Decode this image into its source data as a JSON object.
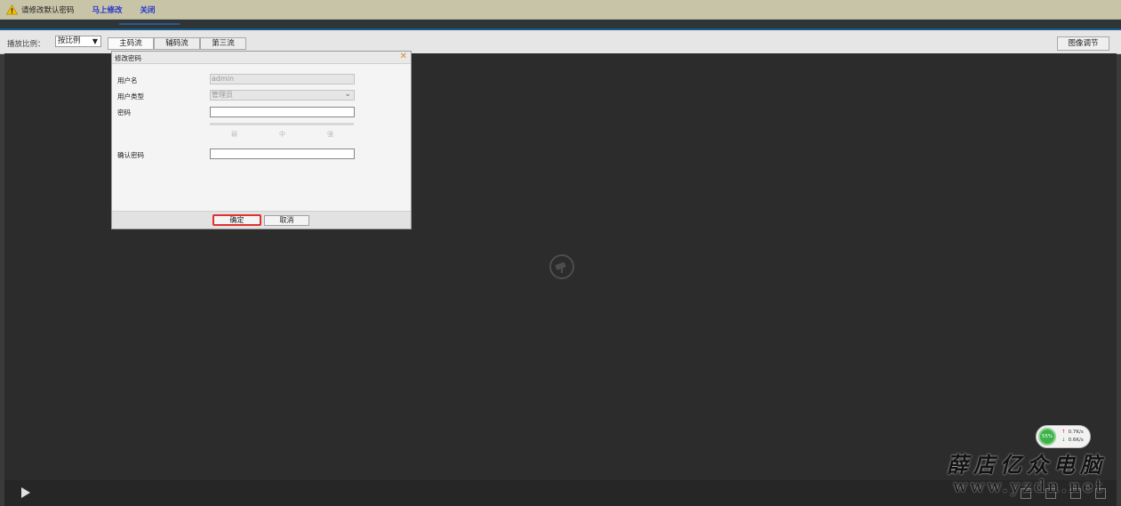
{
  "warning_bar": {
    "icon": "warning-icon",
    "message": "请修改默认密码",
    "modify_link": "马上修改",
    "close_link": "关闭"
  },
  "toolbar": {
    "ratio_label": "播放比例：",
    "ratio_value": "按比例",
    "tabs": [
      "主码流",
      "辅码流",
      "第三流"
    ],
    "image_adjust": "图像调节"
  },
  "dialog": {
    "title": "修改密码",
    "username_label": "用户名",
    "username_value": "admin",
    "usertype_label": "用户类型",
    "usertype_value": "管理员",
    "password_label": "密码",
    "password_value": "",
    "strength_labels": [
      "弱",
      "中",
      "强"
    ],
    "confirm_label": "确认密码",
    "confirm_value": "",
    "ok_button": "确定",
    "cancel_button": "取消"
  },
  "network": {
    "percent": "55%",
    "upload": "0.7K/s",
    "download": "0.6K/s",
    "up_color": "#d22222",
    "down_color": "#22a022"
  },
  "watermark": {
    "line1": "薛店亿众电脑",
    "line2": "www.yzdn.net"
  }
}
